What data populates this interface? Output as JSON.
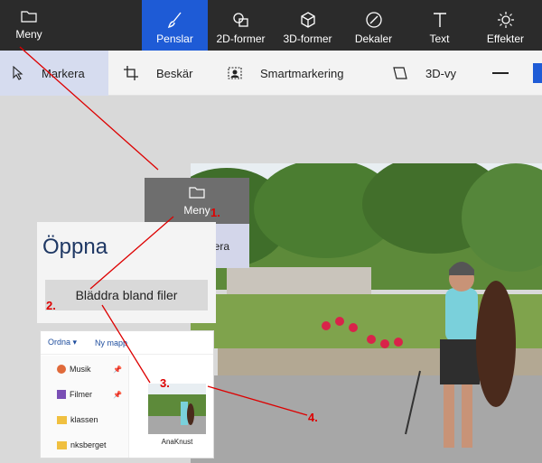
{
  "menu": {
    "label": "Meny"
  },
  "toolbar": {
    "tools": [
      {
        "label": "Penslar",
        "icon": "brush-icon"
      },
      {
        "label": "2D-former",
        "icon": "shapes-2d-icon"
      },
      {
        "label": "3D-former",
        "icon": "cube-3d-icon"
      },
      {
        "label": "Dekaler",
        "icon": "sticker-icon"
      },
      {
        "label": "Text",
        "icon": "text-icon"
      },
      {
        "label": "Effekter",
        "icon": "sun-effects-icon"
      }
    ],
    "active_index": 0
  },
  "subbar": {
    "select": "Markera",
    "crop": "Beskär",
    "smart_select": "Smartmarkering",
    "view3d": "3D-vy"
  },
  "popup_menu": {
    "menu_label": "Meny",
    "select_label": "Markera"
  },
  "open_panel": {
    "title": "Öppna",
    "browse_label": "Bläddra bland filer"
  },
  "explorer": {
    "organize": "Ordna ▾",
    "new_folder": "Ny mapp",
    "nav_items": [
      "Musik",
      "Filmer",
      "klassen",
      "nksberget"
    ],
    "file_name": "AnaKnust"
  },
  "steps": [
    "1.",
    "2.",
    "3.",
    "4."
  ],
  "colors": {
    "accent": "#1e5bd6",
    "annotation": "#dd0000"
  }
}
